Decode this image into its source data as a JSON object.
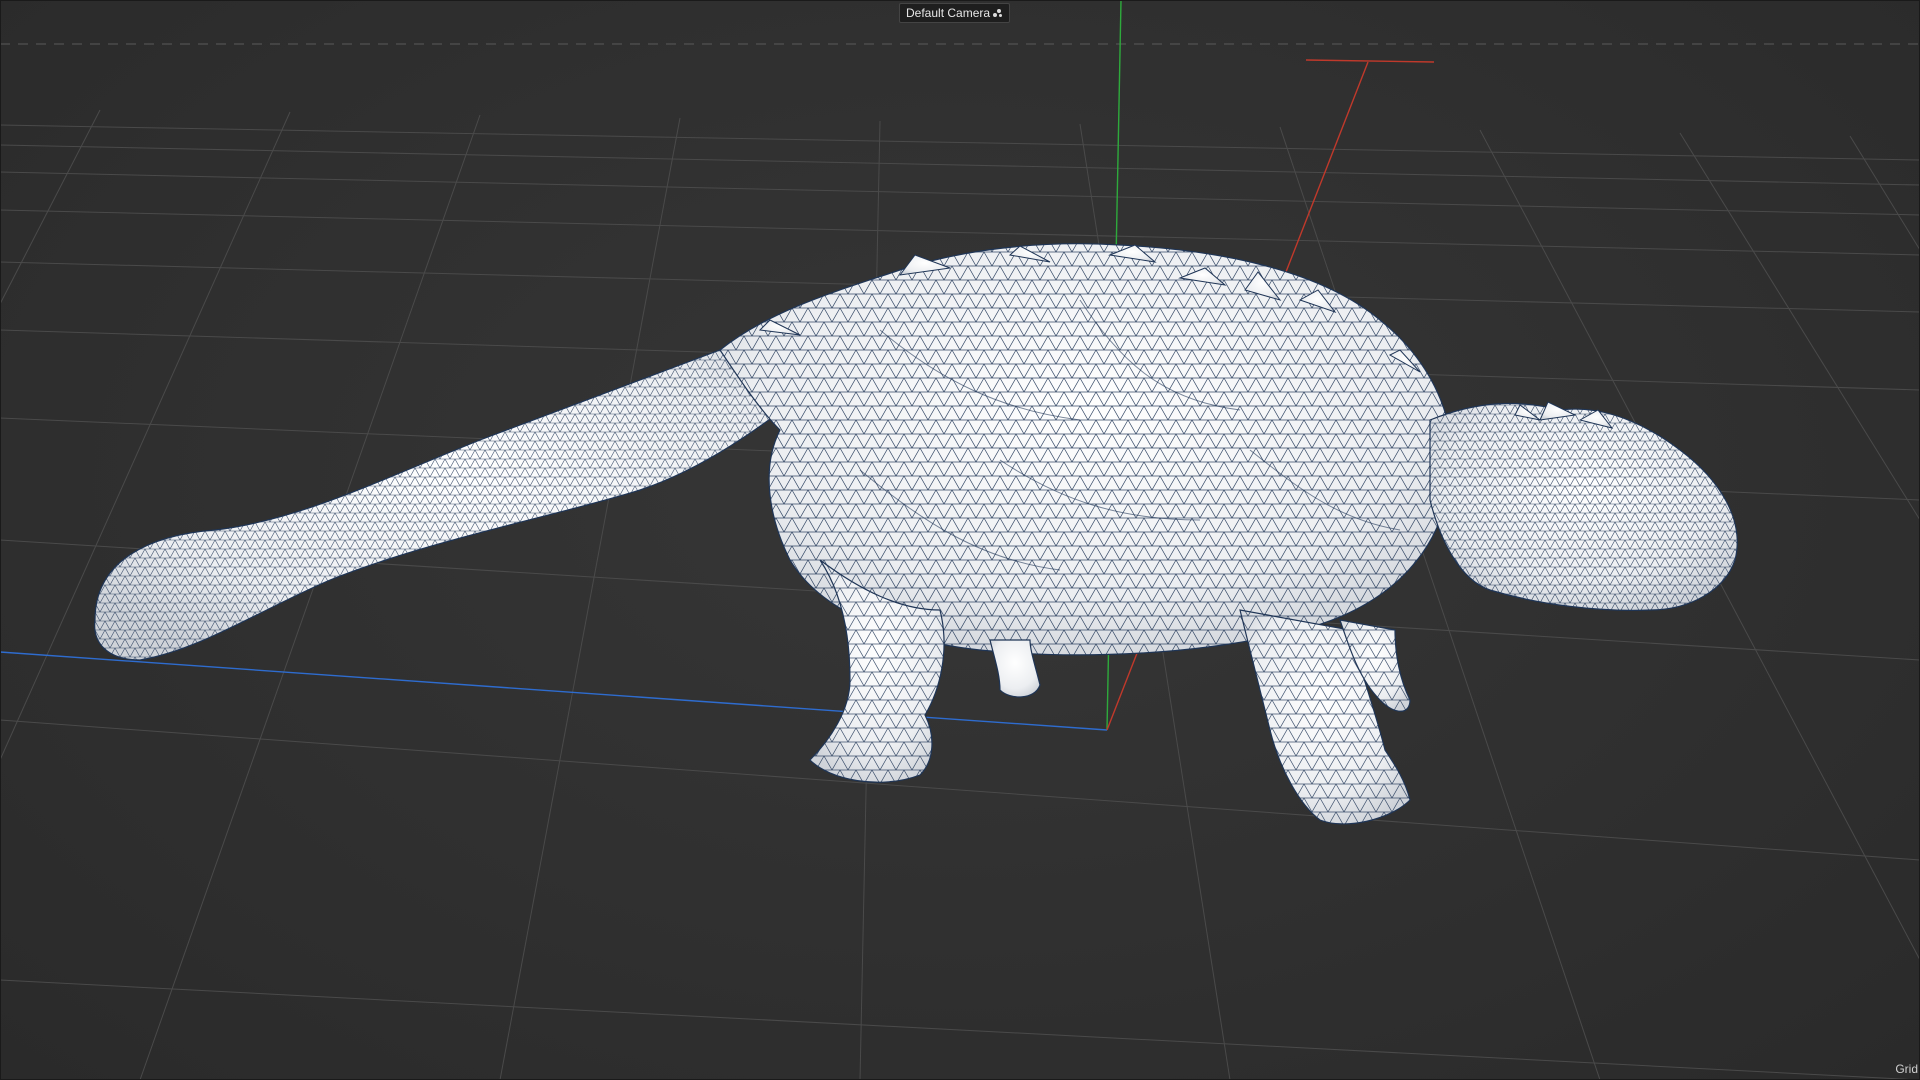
{
  "viewport": {
    "camera_label": "Default Camera",
    "camera_icon": "camera-options-icon",
    "grid_label": "Grid"
  },
  "scene": {
    "object": "ankylosaurus-wireframe-mesh",
    "axis_colors": {
      "x": "#c0392b",
      "y": "#2eaa3c",
      "z": "#2e6ccf"
    },
    "colors": {
      "background": "#2f2f2f",
      "grid_line": "#4a4a4a",
      "mesh_fill": "#f4f5f7",
      "mesh_wire": "#1f3556",
      "label_bg": "#1e1e1e"
    }
  }
}
